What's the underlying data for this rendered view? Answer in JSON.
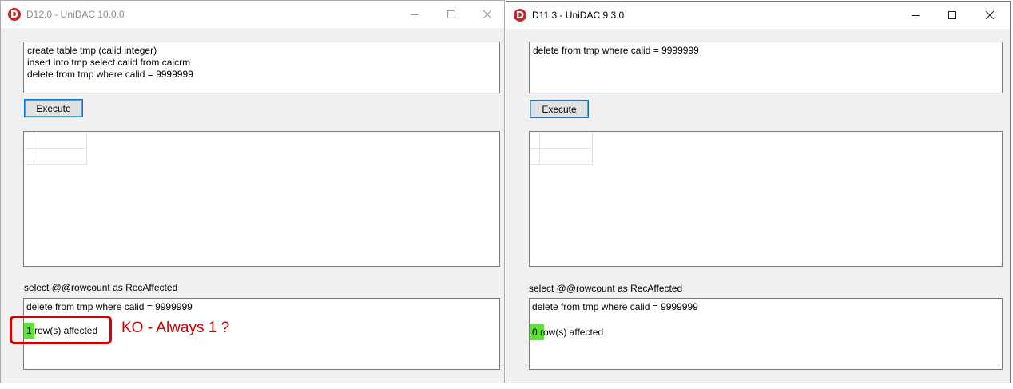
{
  "left": {
    "title": "D12.0 - UniDAC 10.0.0",
    "sql_text": "create table tmp (calid integer)\ninsert into tmp select calid from calcrm\ndelete from tmp where calid = 9999999",
    "execute_label": "Execute",
    "query_label": "select @@rowcount as RecAffected",
    "result_sql": "delete from tmp where calid = 9999999",
    "result_rows": "1 row(s) affected"
  },
  "right": {
    "title": "D11.3 - UniDAC 9.3.0",
    "sql_text": "delete from tmp where calid = 9999999",
    "execute_label": "Execute",
    "query_label": "select @@rowcount as RecAffected",
    "result_sql": "delete from tmp where calid = 9999999",
    "result_rows": "0 row(s) affected"
  },
  "annotation": {
    "text": "KO - Always 1 ?",
    "color": "#d40000"
  },
  "colors": {
    "highlight": "#5ee23a",
    "app_icon": "#c0272d",
    "button_focus": "#0078d7"
  },
  "icons": {
    "app": "delphi-icon",
    "minimize": "minimize-icon",
    "maximize": "maximize-icon",
    "close": "close-icon"
  }
}
